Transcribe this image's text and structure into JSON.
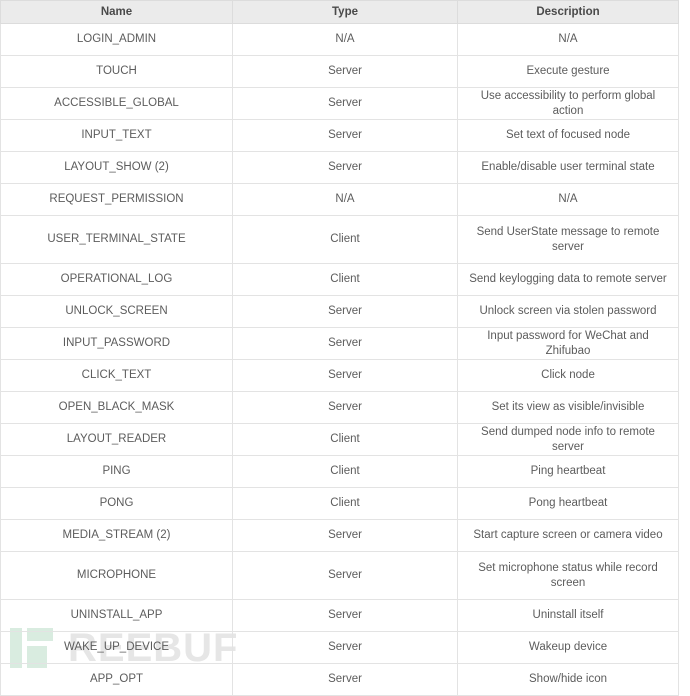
{
  "table": {
    "columns": [
      {
        "key": "name",
        "label": "Name"
      },
      {
        "key": "type",
        "label": "Type"
      },
      {
        "key": "description",
        "label": "Description"
      }
    ],
    "rows": [
      {
        "name": "LOGIN_ADMIN",
        "type": "N/A",
        "description": "N/A",
        "tall": false
      },
      {
        "name": "TOUCH",
        "type": "Server",
        "description": "Execute gesture",
        "tall": false
      },
      {
        "name": "ACCESSIBLE_GLOBAL",
        "type": "Server",
        "description": "Use accessibility to perform global action",
        "tall": false
      },
      {
        "name": "INPUT_TEXT",
        "type": "Server",
        "description": "Set text of focused node",
        "tall": false
      },
      {
        "name": "LAYOUT_SHOW (2)",
        "type": "Server",
        "description": "Enable/disable user terminal state",
        "tall": false
      },
      {
        "name": "REQUEST_PERMISSION",
        "type": "N/A",
        "description": "N/A",
        "tall": false
      },
      {
        "name": "USER_TERMINAL_STATE",
        "type": "Client",
        "description": "Send UserState message to remote server",
        "tall": true
      },
      {
        "name": "OPERATIONAL_LOG",
        "type": "Client",
        "description": "Send keylogging data to remote server",
        "tall": false
      },
      {
        "name": "UNLOCK_SCREEN",
        "type": "Server",
        "description": "Unlock screen via stolen password",
        "tall": false
      },
      {
        "name": "INPUT_PASSWORD",
        "type": "Server",
        "description": "Input password for WeChat and Zhifubao",
        "tall": false
      },
      {
        "name": "CLICK_TEXT",
        "type": "Server",
        "description": "Click node",
        "tall": false
      },
      {
        "name": "OPEN_BLACK_MASK",
        "type": "Server",
        "description": "Set its view as visible/invisible",
        "tall": false
      },
      {
        "name": "LAYOUT_READER",
        "type": "Client",
        "description": "Send dumped node info to remote server",
        "tall": false
      },
      {
        "name": "PING",
        "type": "Client",
        "description": "Ping heartbeat",
        "tall": false
      },
      {
        "name": "PONG",
        "type": "Client",
        "description": "Pong heartbeat",
        "tall": false
      },
      {
        "name": "MEDIA_STREAM (2)",
        "type": "Server",
        "description": "Start capture screen or camera video",
        "tall": false
      },
      {
        "name": "MICROPHONE",
        "type": "Server",
        "description": "Set microphone status while record screen",
        "tall": true
      },
      {
        "name": "UNINSTALL_APP",
        "type": "Server",
        "description": "Uninstall itself",
        "tall": false
      },
      {
        "name": "WAKE_UP_DEVICE",
        "type": "Server",
        "description": "Wakeup device",
        "tall": false
      },
      {
        "name": "APP_OPT",
        "type": "Server",
        "description": "Show/hide icon",
        "tall": false
      }
    ]
  },
  "watermark": {
    "text": "REEBUF",
    "mark_color": "#d9ece0",
    "text_color": "#e6e6e6"
  },
  "colors": {
    "header_bg": "#ebebeb",
    "border": "#e3e3e3",
    "text": "#5c5c5c",
    "page_bg": "#ffffff"
  }
}
